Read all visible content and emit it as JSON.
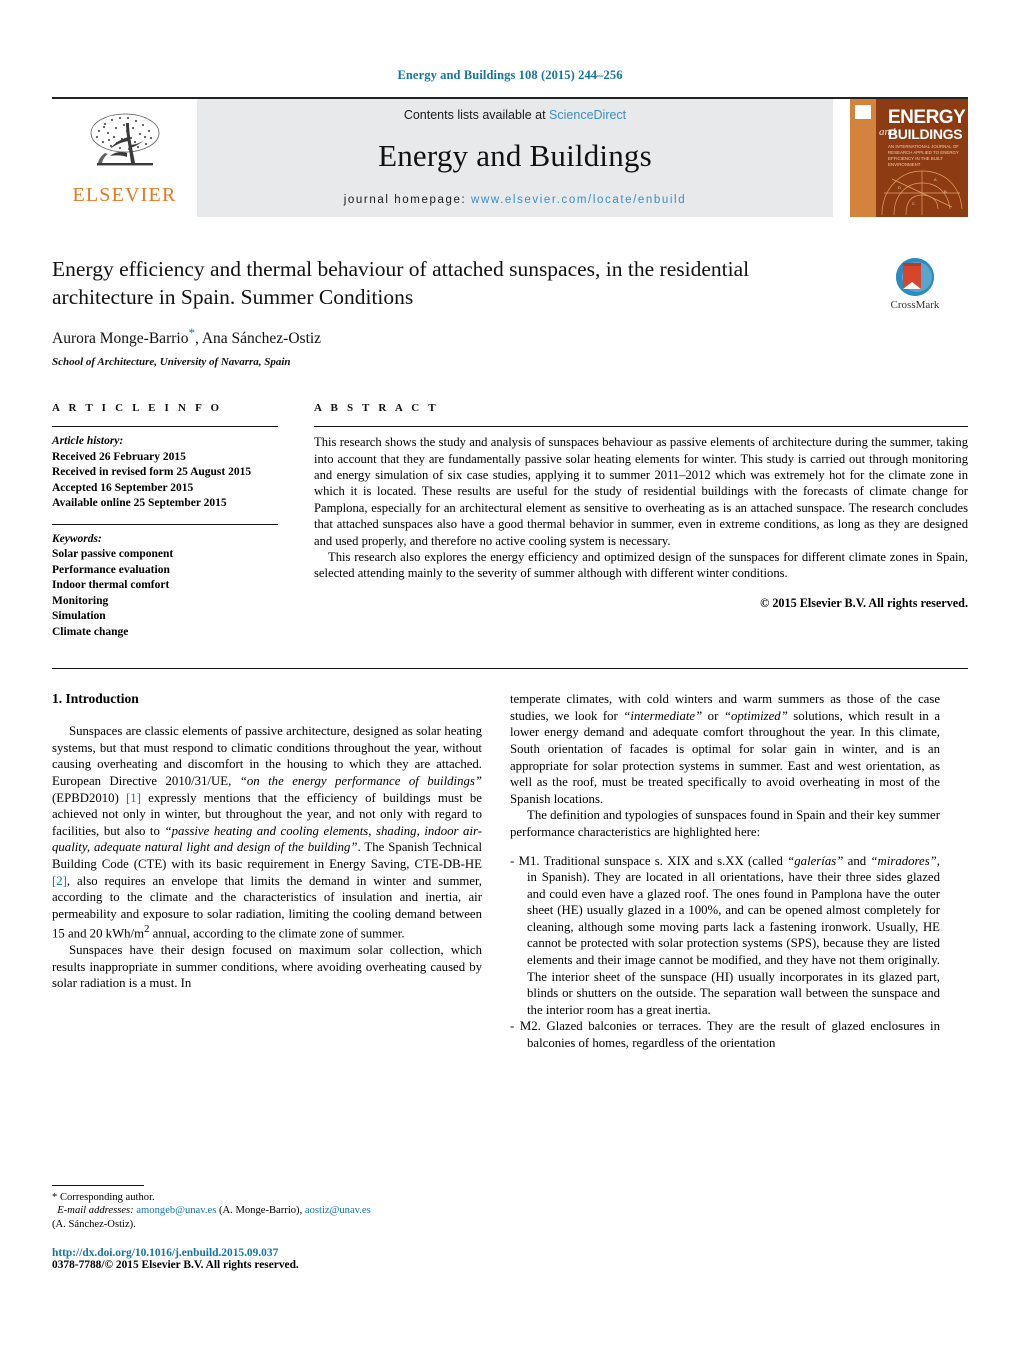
{
  "journal_ref": "Energy and Buildings 108 (2015) 244–256",
  "masthead": {
    "publisher": "ELSEVIER",
    "contents_prefix": "Contents lists available at ",
    "contents_link": "ScienceDirect",
    "journal_title": "Energy and Buildings",
    "homepage_prefix": "journal homepage: ",
    "homepage_url": "www.elsevier.com/locate/enbuild",
    "cover": {
      "word_and": "and",
      "word_energy": "ENERGY",
      "word_buildings": "BUILDINGS",
      "subtitle": "AN INTERNATIONAL JOURNAL OF RESEARCH APPLIED TO ENERGY EFFICIENCY IN THE BUILT ENVIRONMENT"
    }
  },
  "title_block": {
    "title": "Energy efficiency and thermal behaviour of attached sunspaces, in the residential architecture in Spain. Summer Conditions",
    "authors": "Aurora Monge-Barrio",
    "author_star": "*",
    "authors_rest": ", Ana Sánchez-Ostiz",
    "affiliation": "School of Architecture, University of Navarra, Spain",
    "crossmark_label": "CrossMark"
  },
  "article_info": {
    "heading": "A R T I C L E   I N F O",
    "history_label": "Article history:",
    "history": [
      "Received 26 February 2015",
      "Received in revised form 25 August 2015",
      "Accepted 16 September 2015",
      "Available online 25 September 2015"
    ],
    "keywords_label": "Keywords:",
    "keywords": [
      "Solar passive component",
      "Performance evaluation",
      "Indoor thermal comfort",
      "Monitoring",
      "Simulation",
      "Climate change"
    ]
  },
  "abstract": {
    "heading": "A B S T R A C T",
    "paragraph1": "This research shows the study and analysis of sunspaces behaviour as passive elements of architecture during the summer, taking into account that they are fundamentally passive solar heating elements for winter. This study is carried out through monitoring and energy simulation of six case studies, applying it to summer 2011–2012 which was extremely hot for the climate zone in which it is located. These results are useful for the study of residential buildings with the forecasts of climate change for Pamplona, especially for an architectural element as sensitive to overheating as is an attached sunspace. The research concludes that attached sunspaces also have a good thermal behavior in summer, even in extreme conditions, as long as they are designed and used properly, and therefore no active cooling system is necessary.",
    "paragraph2": "This research also explores the energy efficiency and optimized design of the sunspaces for different climate zones in Spain, selected attending mainly to the severity of summer although with different winter conditions.",
    "copyright": "© 2015 Elsevier B.V. All rights reserved."
  },
  "intro": {
    "section_title": "1. Introduction",
    "left_p1_a": "Sunspaces are classic elements of passive architecture, designed as solar heating systems, but that must respond to climatic conditions throughout the year, without causing overheating and discomfort in the housing to which they are attached. European Directive 2010/31/UE, ",
    "left_p1_italic1": "“on the energy performance of buildings”",
    "left_p1_b": " (EPBD2010) ",
    "left_p1_ref1": "[1]",
    "left_p1_c": " expressly mentions that the efficiency of buildings must be achieved not only in winter, but throughout the year, and not only with regard to facilities, but also to ",
    "left_p1_italic2": "“passive heating and cooling elements, shading, indoor air-quality, adequate natural light and design of the building”",
    "left_p1_d": ". The Spanish Technical Building Code (CTE) with its basic requirement in Energy Saving, CTE-DB-HE ",
    "left_p1_ref2": "[2]",
    "left_p1_e": ", also requires an envelope that limits the demand in winter and summer, according to the climate and the characteristics of insulation and inertia, air permeability and exposure to solar radiation, limiting the cooling demand between 15 and 20 kWh/m",
    "left_p1_sup": "2",
    "left_p1_f": " annual, according to the climate zone of summer.",
    "left_p2": "Sunspaces have their design focused on maximum solar collection, which results inappropriate in summer conditions, where avoiding overheating caused by solar radiation is a must. In",
    "right_p1_a": "temperate climates, with cold winters and warm summers as those of the case studies, we look for ",
    "right_p1_italic1": "“intermediate”",
    "right_p1_b": " or ",
    "right_p1_italic2": "“optimized”",
    "right_p1_c": " solutions, which result in a lower energy demand and adequate comfort throughout the year. In this climate, South orientation of facades is optimal for solar gain in winter, and is an appropriate for solar protection systems in summer. East and west orientation, as well as the roof, must be treated specifically to avoid overheating in most of the Spanish locations.",
    "right_p2": "The definition and typologies of sunspaces found in Spain and their key summer performance characteristics are highlighted here:",
    "bullet1_a": "M1. Traditional sunspace s. XIX and s.XX (called ",
    "bullet1_italic1": "“galerías”",
    "bullet1_b": " and ",
    "bullet1_italic2": "“miradores”",
    "bullet1_c": ", in Spanish). They are located in all orientations, have their three sides glazed and could even have a glazed roof. The ones found in Pamplona have the outer sheet (HE) usually glazed in a 100%, and can be opened almost completely for cleaning, although some moving parts lack a fastening ironwork. Usually, HE cannot be protected with solar protection systems (SPS), because they are listed elements and their image cannot be modified, and they have not them originally. The interior sheet of the sunspace (HI) usually incorporates in its glazed part, blinds or shutters on the outside. The separation wall between the sunspace and the interior room has a great inertia.",
    "bullet2": "M2. Glazed balconies or terraces. They are the result of glazed enclosures in balconies of homes, regardless of the orientation",
    "bullet_marker": "-"
  },
  "footnote": {
    "corresponding": "* Corresponding author.",
    "email_label": "E-mail addresses:",
    "email1": "amongeb@unav.es",
    "email1_owner": " (A. Monge-Barrio), ",
    "email2": "aostiz@unav.es",
    "email2_owner": "(A. Sánchez-Ostiz).",
    "doi": "http://dx.doi.org/10.1016/j.enbuild.2015.09.037",
    "issn": "0378-7788/© 2015 Elsevier B.V. All rights reserved."
  },
  "colors": {
    "link": "#1474a4",
    "elsevier_orange": "#e87722",
    "masthead_bg": "#e8e9ea",
    "cover_brown": "#8c3b12",
    "cover_tan": "#d4833c"
  }
}
